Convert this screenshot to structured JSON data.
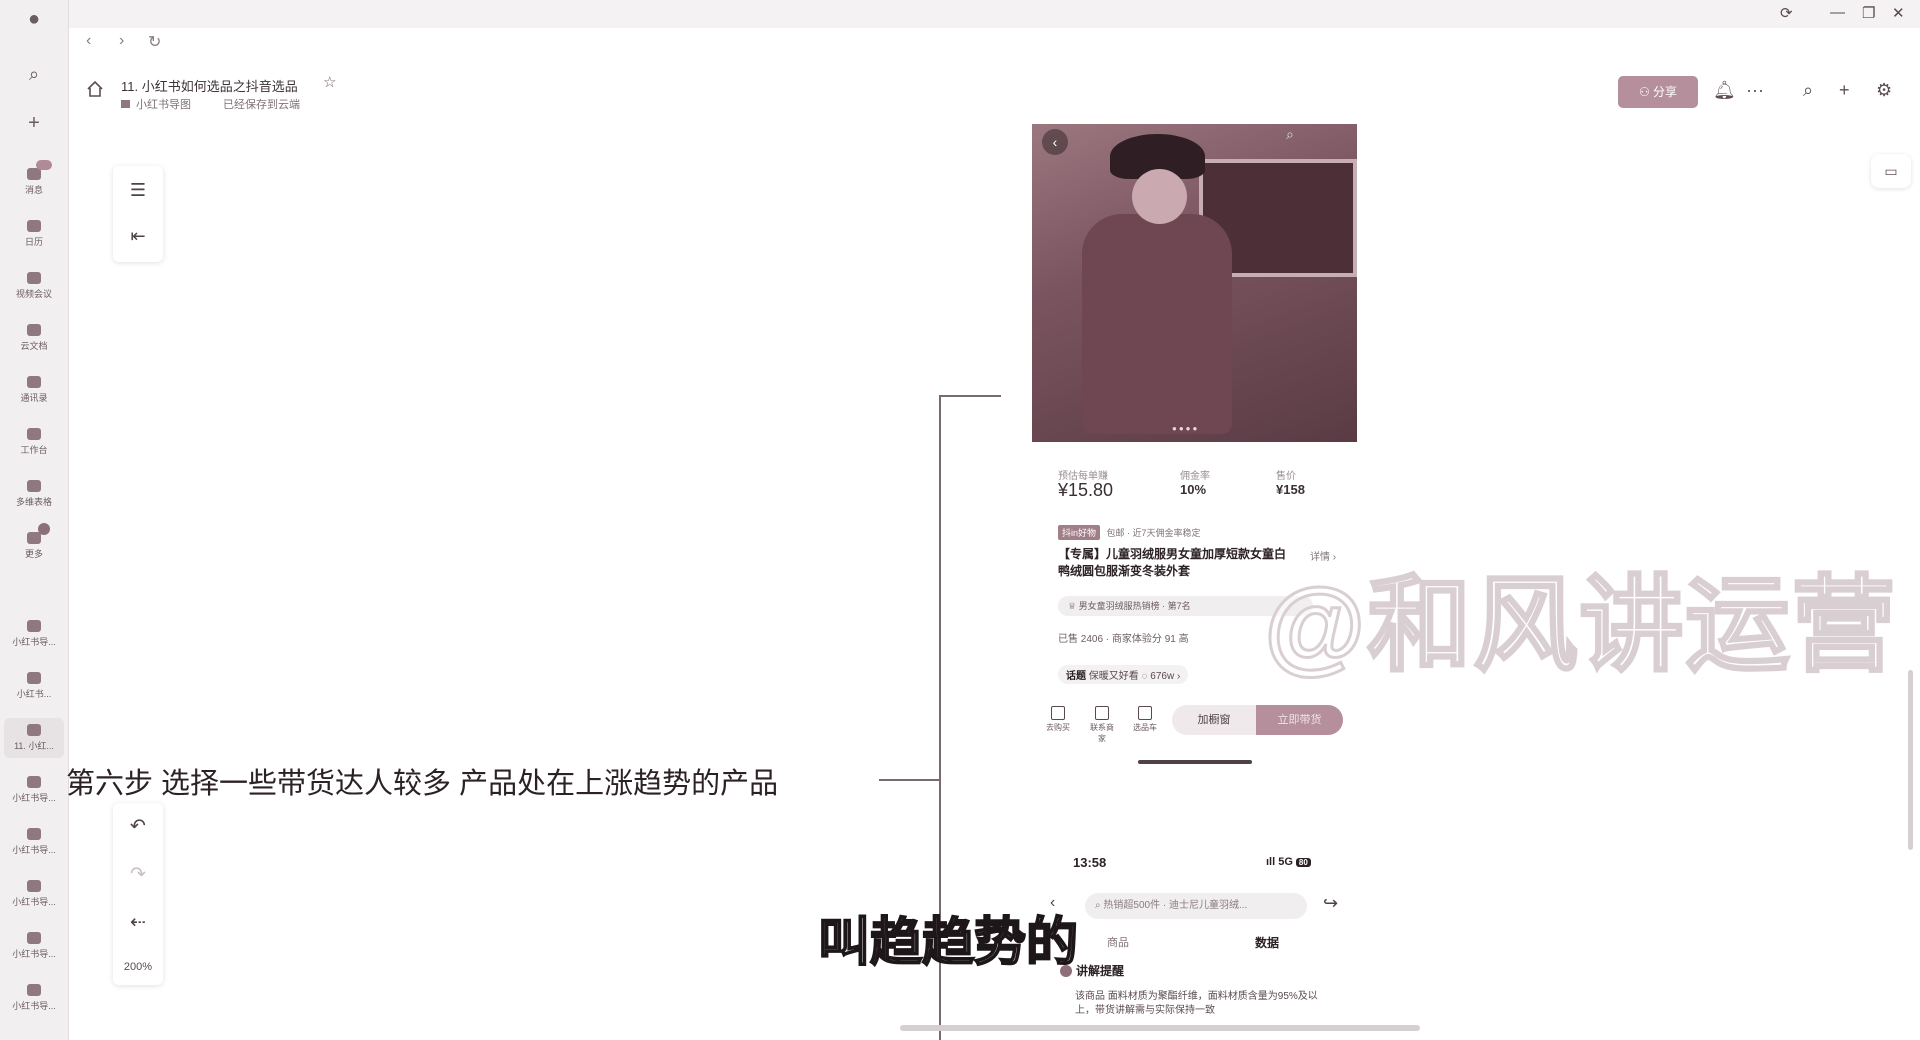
{
  "window": {
    "controls": [
      "⟳",
      "—",
      "❐",
      "✕"
    ]
  },
  "nav": {
    "back": "‹",
    "forward": "›",
    "refresh": "↻"
  },
  "rail": {
    "top_icons": [
      "search-icon",
      "plus-icon"
    ],
    "items": [
      {
        "label": "消息"
      },
      {
        "label": "日历"
      },
      {
        "label": "视频会议"
      },
      {
        "label": "云文档"
      },
      {
        "label": "通讯录"
      },
      {
        "label": "工作台"
      },
      {
        "label": "多维表格"
      },
      {
        "label": "更多"
      },
      {
        "label": "小红书导..."
      },
      {
        "label": "小红书..."
      },
      {
        "label": "11. 小红..."
      },
      {
        "label": "小红书导..."
      },
      {
        "label": "小红书导..."
      },
      {
        "label": "小红书导..."
      },
      {
        "label": "小红书导..."
      },
      {
        "label": "小红书导..."
      }
    ]
  },
  "header": {
    "title": "11. 小红书如何选品之抖音选品",
    "breadcrumb": "小红书导图",
    "save_status": "已经保存到云端",
    "share_label": "分享",
    "icons": [
      "bell-icon",
      "more-icon",
      "search-icon",
      "plus-icon",
      "settings-icon"
    ]
  },
  "toolbar": {
    "zoom": "200%"
  },
  "mindmap": {
    "node_text": "第六步 选择一些带货达人较多 产品处在上涨趋势的产品"
  },
  "product": {
    "metrics": [
      {
        "label": "预估每单赚",
        "value": "¥15.80"
      },
      {
        "label": "佣金率",
        "value": "10%"
      },
      {
        "label": "售价",
        "value": "¥158"
      }
    ],
    "tags": [
      "抖in好物",
      "包邮",
      "近7天佣金率稳定"
    ],
    "title": "【专属】儿童羽绒服男女童加厚短款女童白鸭绒圆包服渐变冬装外套",
    "detail_link": "详情 ›",
    "rank": "男女童羽绒服热销榜 · 第7名",
    "sold": "已售 2406 · 商家体验分 91 高",
    "topic_tag": "话题",
    "topic": "保暖又好看",
    "topic_count": "676w ›",
    "bottom_icons": [
      {
        "label": "去购买",
        "icon": "bag-icon"
      },
      {
        "label": "联系商家",
        "icon": "chat-icon"
      },
      {
        "label": "选品车",
        "icon": "cart-icon"
      }
    ],
    "add_window": "加橱窗",
    "buy": "立即带货"
  },
  "screen2": {
    "time": "13:58",
    "signal": "5G",
    "battery": "80",
    "search": "热销超500件 · 迪士尼儿童羽绒...",
    "tab_goods": "商品",
    "tab_data": "数据",
    "remind_title": "讲解提醒",
    "remind_body": "该商品 面料材质为聚酯纤维，面料材质含量为95%及以上，带货讲解需与实际保持一致"
  },
  "overlay": {
    "watermark": "@和风讲运营",
    "subtitle": "叫趋趋势的"
  },
  "colors": {
    "accent": "#b58f9b",
    "rail": "#f2eff0",
    "line": "#7a6a70"
  }
}
